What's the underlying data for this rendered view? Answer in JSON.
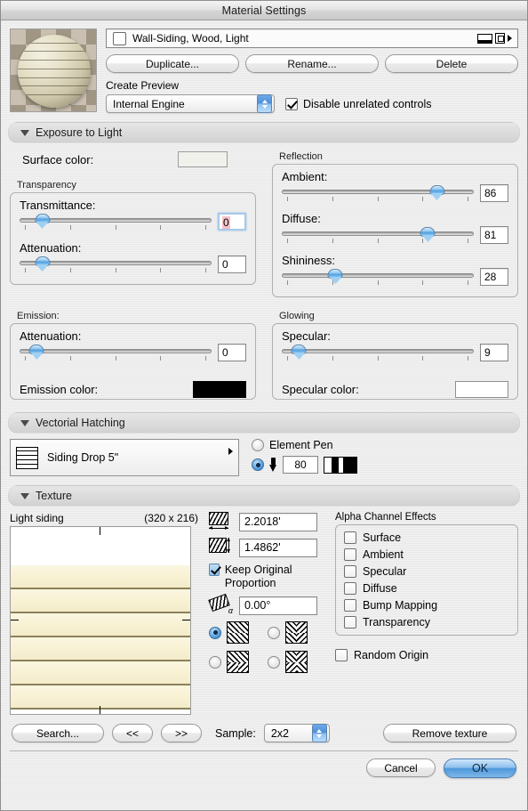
{
  "window": {
    "title": "Material Settings"
  },
  "material": {
    "name": "Wall-Siding, Wood, Light",
    "buttons": {
      "duplicate": "Duplicate...",
      "rename": "Rename...",
      "delete": "Delete"
    },
    "create_preview_label": "Create Preview",
    "engine": "Internal Engine",
    "disable_unrelated": "Disable unrelated controls",
    "disable_unrelated_checked": true
  },
  "exposure": {
    "header": "Exposure to Light",
    "surface_color_label": "Surface color:",
    "surface_color": "#f1f1ec",
    "transparency": {
      "legend": "Transparency",
      "transmittance_label": "Transmittance:",
      "transmittance_value": "0",
      "transmittance_pct": 12,
      "attenuation_label": "Attenuation:",
      "attenuation_value": "0",
      "attenuation_pct": 12
    },
    "reflection": {
      "legend": "Reflection",
      "ambient_label": "Ambient:",
      "ambient_value": "86",
      "ambient_pct": 86,
      "diffuse_label": "Diffuse:",
      "diffuse_value": "81",
      "diffuse_pct": 81,
      "shininess_label": "Shininess:",
      "shininess_value": "28",
      "shininess_pct": 28
    },
    "emission": {
      "legend": "Emission:",
      "attenuation_label": "Attenuation:",
      "attenuation_value": "0",
      "attenuation_pct": 9,
      "color_label": "Emission color:",
      "color": "#000000"
    },
    "glowing": {
      "legend": "Glowing",
      "specular_label": "Specular:",
      "specular_value": "9",
      "specular_pct": 9,
      "color_label": "Specular color:",
      "color": "#ffffff"
    }
  },
  "hatching": {
    "header": "Vectorial Hatching",
    "pattern": "Siding Drop  5\"",
    "element_pen_label": "Element Pen",
    "element_pen_selected": false,
    "custom_pen_selected": true,
    "pen_number": "80"
  },
  "texture": {
    "header": "Texture",
    "name": "Light siding",
    "size": "(320 x 216)",
    "width_value": "2.2018'",
    "height_value": "1.4862'",
    "angle_value": "0.00°",
    "keep_proportion_label": "Keep Original Proportion",
    "keep_proportion_checked": true,
    "mirror_selected_index": 0,
    "alpha": {
      "legend": "Alpha Channel Effects",
      "items": [
        {
          "label": "Surface",
          "checked": false
        },
        {
          "label": "Ambient",
          "checked": false
        },
        {
          "label": "Specular",
          "checked": false
        },
        {
          "label": "Diffuse",
          "checked": false
        },
        {
          "label": "Bump Mapping",
          "checked": false
        },
        {
          "label": "Transparency",
          "checked": false
        }
      ]
    },
    "random_origin_label": "Random Origin",
    "random_origin_checked": false
  },
  "bottom": {
    "search": "Search...",
    "prev": "<<",
    "next": ">>",
    "sample_label": "Sample:",
    "sample_value": "2x2",
    "remove_texture": "Remove texture",
    "cancel": "Cancel",
    "ok": "OK"
  }
}
